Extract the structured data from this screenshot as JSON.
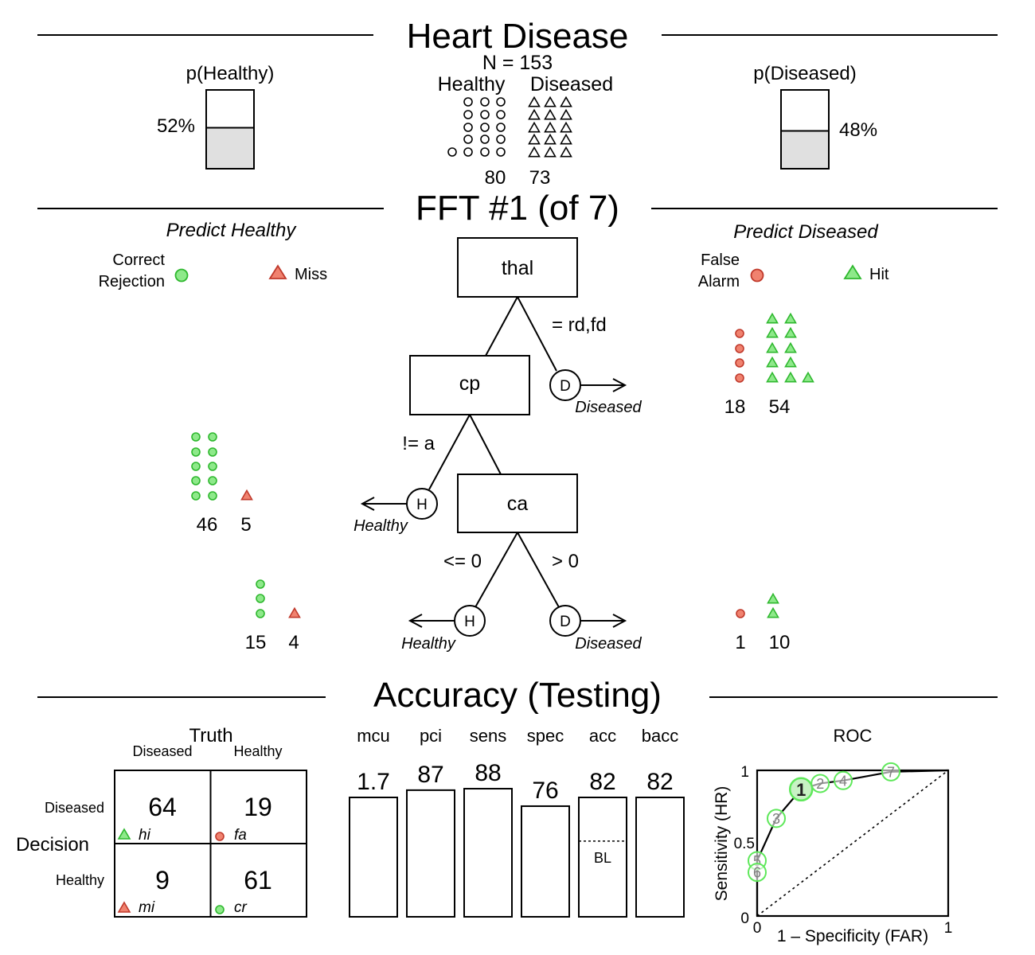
{
  "colors": {
    "correct_fill": "#8ee98a",
    "correct_stroke": "#2eb82e",
    "error_fill": "#f0826f",
    "error_stroke": "#c0392b",
    "roc_circle": "#5ee85a",
    "roc_selected_fill": "#c8f2c4",
    "bar_fill_light": "#e0e0e0"
  },
  "chart_data": [
    {
      "type": "icon-array",
      "title": "Heart Disease",
      "n_label": "N = 153",
      "p_healthy": {
        "label": "p(Healthy)",
        "value": 0.52,
        "text": "52%"
      },
      "p_diseased": {
        "label": "p(Diseased)",
        "value": 0.48,
        "text": "48%"
      },
      "classes": [
        {
          "name": "Healthy",
          "count": 80,
          "count_text": "80",
          "icon": "circle-outline",
          "icons_shown": 16
        },
        {
          "name": "Diseased",
          "count": 73,
          "count_text": "73",
          "icon": "triangle-outline",
          "icons_shown": 15
        }
      ]
    },
    {
      "type": "tree",
      "title": "FFT #1 (of 7)",
      "left_header": "Predict Healthy",
      "right_header": "Predict Diseased",
      "legend": {
        "correct_rejection": "Correct\nRejection",
        "correct_rejection_lines": [
          "Correct",
          "Rejection"
        ],
        "miss": "Miss",
        "false_alarm_lines": [
          "False",
          "Alarm"
        ],
        "hit": "Hit"
      },
      "nodes": [
        {
          "cue": "thal",
          "exit_label": "= rd,fd",
          "exit_letter": "D",
          "exit_decision": "Diseased",
          "exit_side": "right",
          "counts": {
            "false_alarm": 18,
            "hit": 54
          },
          "icons": {
            "circles": 4,
            "triangles": 11
          }
        },
        {
          "cue": "cp",
          "exit_label": "!= a",
          "exit_letter": "H",
          "exit_decision": "Healthy",
          "exit_side": "left",
          "counts": {
            "correct_rejection": 46,
            "miss": 5
          },
          "icons": {
            "circles": 10,
            "triangles": 1
          }
        },
        {
          "cue": "ca",
          "exit_label_left": "<= 0",
          "exit_label_right": "> 0",
          "left_exit": {
            "letter": "H",
            "decision": "Healthy",
            "counts": {
              "correct_rejection": 15,
              "miss": 4
            },
            "icons": {
              "circles": 3,
              "triangles": 1
            }
          },
          "right_exit": {
            "letter": "D",
            "decision": "Diseased",
            "counts": {
              "false_alarm": 1,
              "hit": 10
            },
            "icons": {
              "circles": 1,
              "triangles": 2
            }
          }
        }
      ]
    },
    {
      "type": "table",
      "title": "Accuracy (Testing)",
      "confusion_matrix": {
        "truth_label": "Truth",
        "decision_label": "Decision",
        "col_labels": [
          "Diseased",
          "Healthy"
        ],
        "row_labels": [
          "Diseased",
          "Healthy"
        ],
        "cells": [
          {
            "value": 64,
            "text": "64",
            "code": "hi",
            "icon": "triangle",
            "tone": "correct"
          },
          {
            "value": 19,
            "text": "19",
            "code": "fa",
            "icon": "circle",
            "tone": "error"
          },
          {
            "value": 9,
            "text": "9",
            "code": "mi",
            "icon": "triangle",
            "tone": "error"
          },
          {
            "value": 61,
            "text": "61",
            "code": "cr",
            "icon": "circle",
            "tone": "correct"
          }
        ]
      }
    },
    {
      "type": "bar",
      "categories": [
        "mcu",
        "pci",
        "sens",
        "spec",
        "acc",
        "bacc"
      ],
      "values": [
        1.7,
        87,
        88,
        76,
        82,
        82
      ],
      "value_labels": [
        "1.7",
        "87",
        "88",
        "76",
        "82",
        "82"
      ],
      "bar_levels": [
        0.82,
        0.87,
        0.88,
        0.76,
        0.82,
        0.82
      ],
      "baseline": {
        "category": "acc",
        "label": "BL",
        "value": 0.52
      },
      "ylim": [
        0,
        100
      ]
    },
    {
      "type": "line",
      "title": "ROC",
      "xlabel": "1 – Specificity (FAR)",
      "ylabel": "Sensitivity (HR)",
      "xlim": [
        0,
        1
      ],
      "ylim": [
        0,
        1
      ],
      "x_ticks": [
        "0",
        "1"
      ],
      "y_ticks": [
        "0",
        "0.5",
        "1"
      ],
      "selected_tree": 1,
      "points": [
        {
          "label": "1",
          "far": 0.23,
          "hr": 0.87
        },
        {
          "label": "2",
          "far": 0.33,
          "hr": 0.91
        },
        {
          "label": "3",
          "far": 0.1,
          "hr": 0.67
        },
        {
          "label": "4",
          "far": 0.45,
          "hr": 0.93
        },
        {
          "label": "5",
          "far": 0.0,
          "hr": 0.38
        },
        {
          "label": "6",
          "far": 0.0,
          "hr": 0.3
        },
        {
          "label": "7",
          "far": 0.7,
          "hr": 0.99
        }
      ],
      "chance_line": true
    }
  ]
}
